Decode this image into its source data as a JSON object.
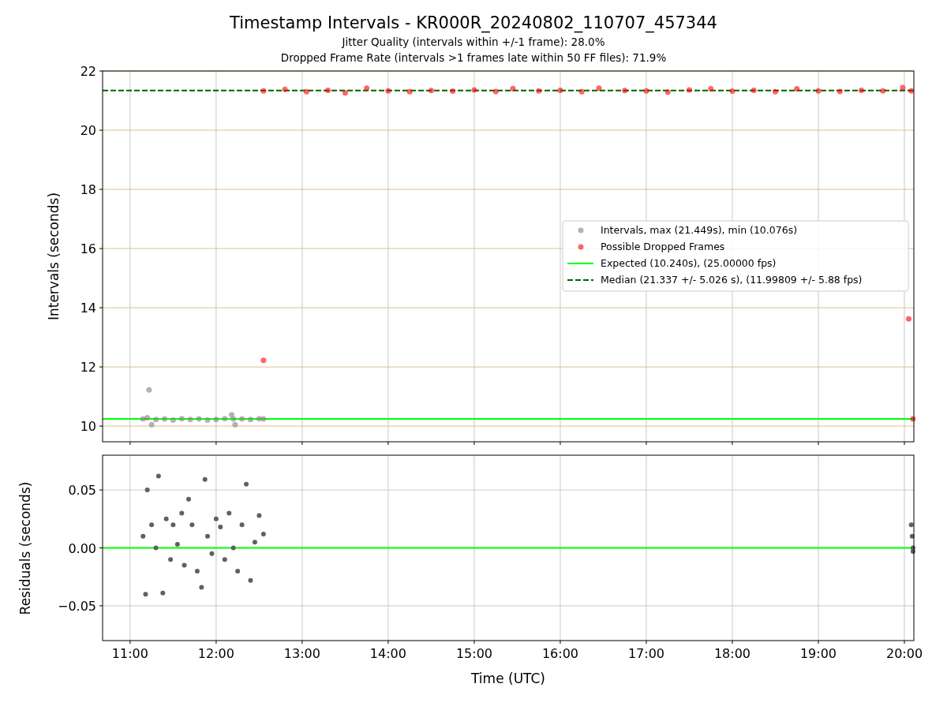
{
  "figure": {
    "title": "Timestamp Intervals - KR000R_20240802_110707_457344",
    "subtitles": [
      "Jitter Quality (intervals within +/-1 frame): 28.0%",
      "Dropped Frame Rate (intervals >1 frames late within 50 FF files): 71.9%"
    ]
  },
  "intervals_plot": {
    "chart_data": {
      "type": "scatter",
      "ylabel": "Intervals (seconds)",
      "xlim": [
        10.68,
        20.11
      ],
      "ylim": [
        9.47,
        22
      ],
      "grid": true,
      "yticks": [
        {
          "value": 10,
          "label": "10"
        },
        {
          "value": 12,
          "label": "12"
        },
        {
          "value": 14,
          "label": "14"
        },
        {
          "value": 16,
          "label": "16"
        },
        {
          "value": 18,
          "label": "18"
        },
        {
          "value": 20,
          "label": "20"
        },
        {
          "value": 22,
          "label": "22"
        }
      ],
      "series": [
        {
          "name": "Intervals, max (21.449s), min (10.076s)",
          "color": "#808080",
          "x": [
            11.15,
            11.2,
            11.22,
            11.25,
            11.3,
            11.4,
            11.5,
            11.6,
            11.7,
            11.8,
            11.9,
            12.0,
            12.1,
            12.18,
            12.2,
            12.22,
            12.3,
            12.4,
            12.5,
            12.55
          ],
          "values": [
            10.24,
            10.28,
            11.22,
            10.05,
            10.22,
            10.24,
            10.2,
            10.25,
            10.22,
            10.24,
            10.2,
            10.22,
            10.25,
            10.38,
            10.24,
            10.05,
            10.24,
            10.22,
            10.25,
            10.24
          ]
        },
        {
          "name": "Possible Dropped Frames",
          "color": "#ff0000",
          "x": [
            12.55,
            12.55,
            12.8,
            13.05,
            13.3,
            13.5,
            13.75,
            14.0,
            14.25,
            14.5,
            14.75,
            15.0,
            15.25,
            15.45,
            15.75,
            16.0,
            16.25,
            16.45,
            16.75,
            17.0,
            17.25,
            17.5,
            17.75,
            18.0,
            18.25,
            18.5,
            18.75,
            19.0,
            19.25,
            19.5,
            19.75,
            19.98,
            20.05,
            20.08,
            20.1
          ],
          "values": [
            12.22,
            21.33,
            21.38,
            21.3,
            21.35,
            21.26,
            21.42,
            21.33,
            21.3,
            21.34,
            21.32,
            21.36,
            21.31,
            21.41,
            21.33,
            21.35,
            21.3,
            21.42,
            21.34,
            21.33,
            21.29,
            21.36,
            21.4,
            21.32,
            21.35,
            21.3,
            21.4,
            21.33,
            21.31,
            21.35,
            21.33,
            21.44,
            13.62,
            21.33,
            10.24
          ]
        }
      ],
      "ref_lines": [
        {
          "axis": "y",
          "value": 10.24,
          "label": "Expected (10.240s), (25.00000 fps)",
          "color": "#00ff00"
        },
        {
          "axis": "y",
          "value": 21.337,
          "label": "Median (21.337 +/- 5.026 s), (11.99809 +/- 5.88 fps)",
          "color": "#006400"
        }
      ],
      "legend": true
    }
  },
  "residuals_plot": {
    "chart_data": {
      "type": "scatter",
      "xlabel": "Time (UTC)",
      "ylabel": "Residuals (seconds)",
      "xlim": [
        10.68,
        20.11
      ],
      "ylim": [
        -0.08,
        0.08
      ],
      "grid": true,
      "xticks": [
        {
          "value": 11,
          "label": "11:00"
        },
        {
          "value": 12,
          "label": "12:00"
        },
        {
          "value": 13,
          "label": "13:00"
        },
        {
          "value": 14,
          "label": "14:00"
        },
        {
          "value": 15,
          "label": "15:00"
        },
        {
          "value": 16,
          "label": "16:00"
        },
        {
          "value": 17,
          "label": "17:00"
        },
        {
          "value": 18,
          "label": "18:00"
        },
        {
          "value": 19,
          "label": "19:00"
        },
        {
          "value": 20,
          "label": "20:00"
        }
      ],
      "yticks": [
        {
          "value": 0.05,
          "label": "0.05"
        },
        {
          "value": 0,
          "label": "0.00"
        },
        {
          "value": -0.05,
          "label": "−0.05"
        }
      ],
      "series": [
        {
          "color": "#606060",
          "x": [
            11.15,
            11.18,
            11.2,
            11.25,
            11.3,
            11.33,
            11.38,
            11.42,
            11.47,
            11.5,
            11.55,
            11.6,
            11.63,
            11.68,
            11.72,
            11.78,
            11.83,
            11.87,
            11.9,
            11.95,
            12.0,
            12.05,
            12.1,
            12.15,
            12.2,
            12.25,
            12.3,
            12.35,
            12.4,
            12.45,
            12.5,
            12.55,
            20.08,
            20.09,
            20.1,
            20.1
          ],
          "values": [
            0.01,
            -0.04,
            0.05,
            0.02,
            0.0,
            0.062,
            -0.039,
            0.025,
            -0.01,
            0.02,
            0.003,
            0.03,
            -0.015,
            0.042,
            0.02,
            -0.02,
            -0.034,
            0.059,
            0.01,
            -0.005,
            0.025,
            0.018,
            -0.01,
            0.03,
            0.0,
            -0.02,
            0.02,
            0.055,
            -0.028,
            0.005,
            0.028,
            0.012,
            0.02,
            0.01,
            0.0,
            -0.003
          ]
        }
      ],
      "ref_lines": [
        {
          "axis": "y",
          "value": 0,
          "color": "#00ff00"
        }
      ]
    }
  }
}
